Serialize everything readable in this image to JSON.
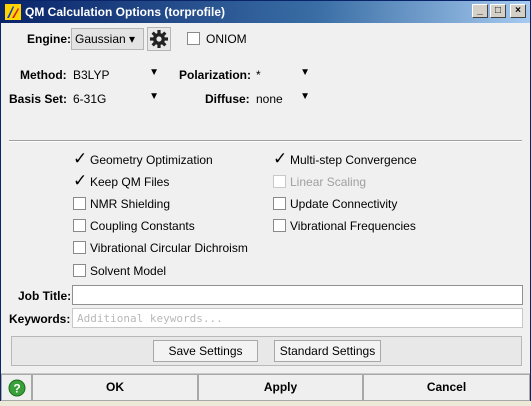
{
  "window": {
    "title": "QM Calculation Options (torprofile)",
    "controls": {
      "minimize": "_",
      "maximize": "□",
      "close": "×"
    }
  },
  "engine": {
    "label": "Engine:",
    "value": "Gaussian ▾",
    "oniom_label": "ONIOM",
    "oniom_checked": false
  },
  "method": {
    "label": "Method:",
    "value": "B3LYP"
  },
  "basis": {
    "label": "Basis Set:",
    "value": "6-31G"
  },
  "polarization": {
    "label": "Polarization:",
    "value": "*"
  },
  "diffuse": {
    "label": "Diffuse:",
    "value": "none"
  },
  "dropdown_arrow": "▼",
  "check_mark": "✓",
  "options": {
    "geometry_optimization": {
      "label": "Geometry Optimization",
      "checked": true
    },
    "keep_qm_files": {
      "label": "Keep QM Files",
      "checked": true
    },
    "nmr_shielding": {
      "label": "NMR Shielding",
      "checked": false
    },
    "coupling_constants": {
      "label": "Coupling Constants",
      "checked": false
    },
    "vcd": {
      "label": "Vibrational Circular Dichroism",
      "checked": false
    },
    "solvent_model": {
      "label": "Solvent Model",
      "checked": false
    },
    "multistep_convergence": {
      "label": "Multi-step Convergence",
      "checked": true
    },
    "linear_scaling": {
      "label": "Linear Scaling",
      "checked": false,
      "disabled": true
    },
    "update_connectivity": {
      "label": "Update Connectivity",
      "checked": false
    },
    "vibrational_frequencies": {
      "label": "Vibrational Frequencies",
      "checked": false
    }
  },
  "job_title": {
    "label": "Job Title:",
    "value": ""
  },
  "keywords": {
    "label": "Keywords:",
    "value": "",
    "placeholder": "Additional keywords..."
  },
  "settings": {
    "save_label": "Save Settings",
    "standard_label": "Standard Settings"
  },
  "footer": {
    "help_glyph": "?",
    "ok_label": "OK",
    "apply_label": "Apply",
    "cancel_label": "Cancel"
  },
  "colors": {
    "title_start": "#0a246a",
    "title_end": "#a6caf0",
    "help_green": "#3aa03a"
  }
}
